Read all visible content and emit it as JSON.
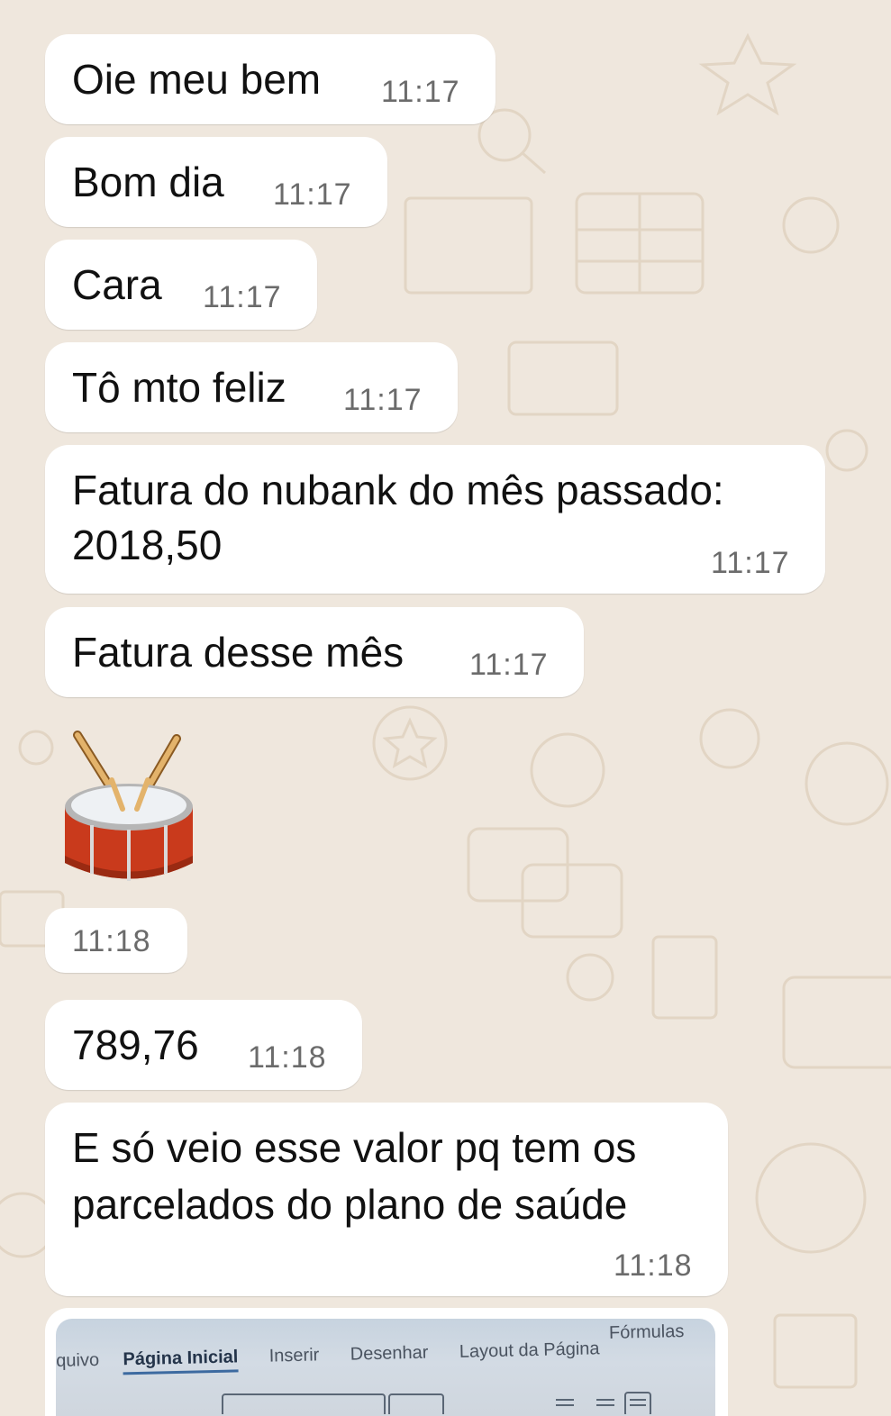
{
  "chat": {
    "messages": [
      {
        "text": "Oie meu bem",
        "time": "11:17"
      },
      {
        "text": "Bom dia",
        "time": "11:17"
      },
      {
        "text": "Cara",
        "time": "11:17"
      },
      {
        "text": "Tô mto feliz",
        "time": "11:17"
      },
      {
        "line1": "Fatura do nubank do mês passado:",
        "line2": "2018,50",
        "time": "11:17"
      },
      {
        "text": "Fatura desse mês",
        "time": "11:17"
      },
      {
        "sticker": "drum-emoji",
        "time": "11:18"
      },
      {
        "text": "789,76",
        "time": "11:18"
      },
      {
        "line1": "E só veio esse valor pq tem os",
        "line2": "parcelados do plano de saúde",
        "time": "11:18"
      }
    ],
    "image_message": {
      "ribbon_tabs": [
        "quivo",
        "Página Inicial",
        "Inserir",
        "Desenhar",
        "Layout da Página",
        "Fórmulas"
      ],
      "active_tab": "Página Inicial"
    }
  },
  "colors": {
    "wallpaper": "#efe7dd",
    "bubble": "#ffffff",
    "timestamp": "#6b6b6b",
    "text": "#111111"
  }
}
